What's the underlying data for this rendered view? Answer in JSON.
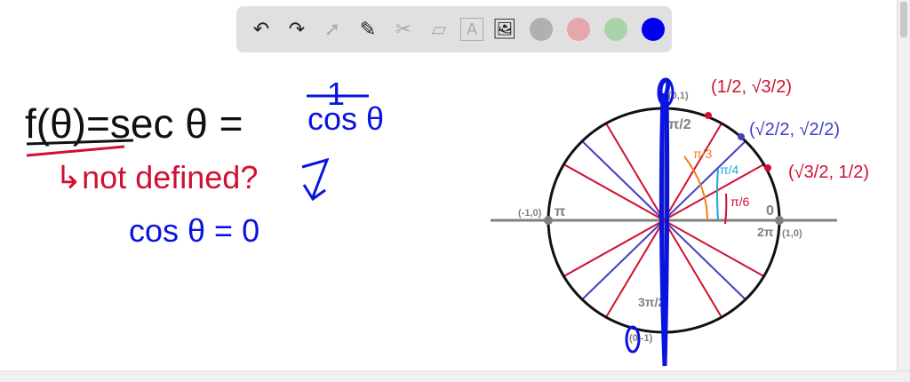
{
  "toolbar": {
    "tools": [
      {
        "name": "undo-icon",
        "glyph": "↶"
      },
      {
        "name": "redo-icon",
        "glyph": "↷"
      },
      {
        "name": "select-icon",
        "glyph": "➚"
      },
      {
        "name": "pen-icon",
        "glyph": "✎"
      },
      {
        "name": "tools-icon",
        "glyph": "✂"
      },
      {
        "name": "eraser-icon",
        "glyph": "▱"
      },
      {
        "name": "text-icon",
        "glyph": "A"
      },
      {
        "name": "image-icon",
        "glyph": "🖼"
      }
    ],
    "colors": [
      "#b0b0b0",
      "#e6a6ac",
      "#a9d4a9",
      "#0000ee"
    ]
  },
  "notes": {
    "line1_left": "f(θ)=sec θ =",
    "frac_num": "1",
    "frac_den": "cos θ",
    "line2": "↳not defined?",
    "line3": "cos θ = 0"
  },
  "circle": {
    "top": "(0,1)",
    "pi_half": "π/2",
    "left": "(-1,0)",
    "pi": "π",
    "right": "(1,0)",
    "zero": "0",
    "two_pi": "2π",
    "three_pi_half": "3π/2",
    "bottom": "(0,-1)",
    "p60": "(1/2, √3/2)",
    "p45": "(√2/2, √2/2)",
    "p30": "(√3/2, 1/2)",
    "a60": "π/3",
    "a45": "π/4",
    "a30": "π/6"
  },
  "colors": {
    "red": "#d01030",
    "blue": "#4040c0",
    "pen": "#0a14e0",
    "orange": "#f08020",
    "cyan": "#20a8d8",
    "gray": "#808080"
  }
}
